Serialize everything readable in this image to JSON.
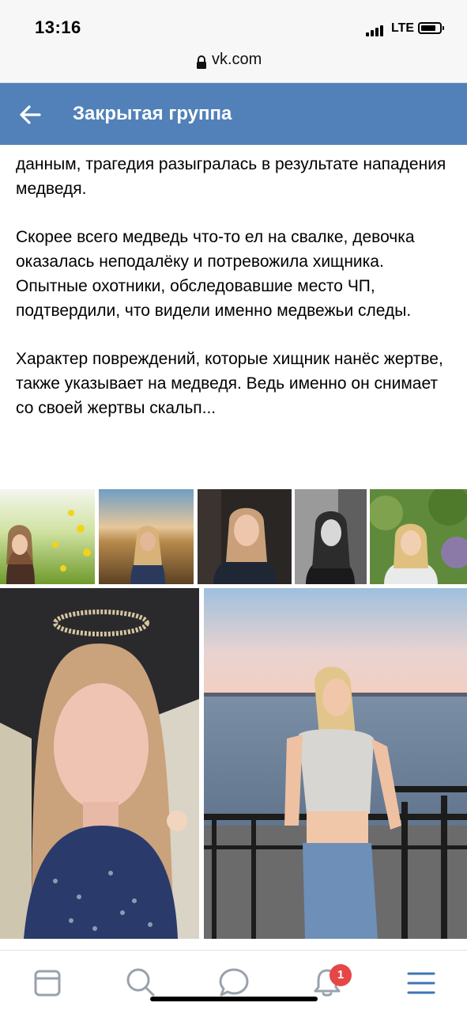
{
  "status_bar": {
    "time": "13:16",
    "network": "LTE"
  },
  "browser": {
    "url": "vk.com"
  },
  "header": {
    "title": "Закрытая группа",
    "back_icon": "arrow-left-icon"
  },
  "post": {
    "paragraphs": [
      "данным, трагедия разыгралась в результате нападения медведя.",
      "Скорее всего медведь что-то ел на свалке, девочка оказалась неподалёку и потревожила хищника. Опытные охотники, обследовавшие место ЧП, подтвердили, что видели именно медвежьи следы.",
      "Характер повреждений, которые хищник нанёс жертве, также указывает на медведя. Ведь именно он снимает со своей жертвы скальп..."
    ],
    "photos": {
      "thumbnails": [
        "photo-field-flowers",
        "photo-wheat-field-sunset",
        "photo-dark-portrait",
        "photo-bw-portrait",
        "photo-greenery-portrait"
      ],
      "large": [
        "photo-halo-selfie",
        "photo-riverside-railing"
      ]
    }
  },
  "bottom_nav": {
    "items": [
      "newsfeed-icon",
      "search-icon",
      "messages-icon",
      "notifications-icon",
      "menu-icon"
    ],
    "notification_count": "1"
  },
  "colors": {
    "vk_blue": "#5181b8",
    "badge_red": "#e64646",
    "nav_icon": "#99a2ad"
  }
}
